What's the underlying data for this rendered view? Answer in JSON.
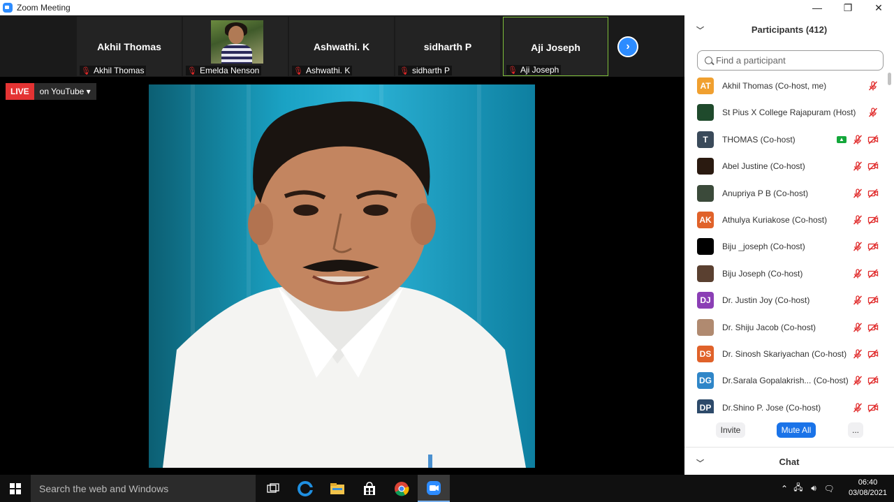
{
  "window": {
    "title": "Zoom Meeting",
    "controls": {
      "minimize": "—",
      "restore": "❐",
      "close": "✕"
    }
  },
  "video_strip": {
    "tiles": [
      {
        "big_name": "Akhil Thomas",
        "label": "Akhil Thomas",
        "has_photo": false,
        "active": false
      },
      {
        "big_name": "",
        "label": "Emelda Nenson",
        "has_photo": true,
        "active": false
      },
      {
        "big_name": "Ashwathi. K",
        "label": "Ashwathi. K",
        "has_photo": false,
        "active": false
      },
      {
        "big_name": "sidharth P",
        "label": "sidharth P",
        "has_photo": false,
        "active": false
      },
      {
        "big_name": "Aji Joseph",
        "label": "Aji Joseph",
        "has_photo": false,
        "active": true
      }
    ],
    "next_icon": "chevron-right-icon"
  },
  "live": {
    "badge": "LIVE",
    "platform": "on YouTube ▾"
  },
  "participants_panel": {
    "title": "Participants (412)",
    "search_placeholder": "Find a participant",
    "participants": [
      {
        "initials": "AT",
        "color": "#f0a030",
        "name": "Akhil Thomas (Co-host, me)",
        "mic_muted": true,
        "video_off": false,
        "sharing": false,
        "avatar_type": "initials"
      },
      {
        "initials": "",
        "color": "#1f4a2c",
        "name": "St Pius X College Rajapuram (Host)",
        "mic_muted": true,
        "video_off": false,
        "sharing": false,
        "avatar_type": "photo"
      },
      {
        "initials": "T",
        "color": "#3a4a5a",
        "name": "THOMAS (Co-host)",
        "mic_muted": true,
        "video_off": true,
        "sharing": true,
        "avatar_type": "initials"
      },
      {
        "initials": "",
        "color": "#2a1a10",
        "name": "Abel Justine (Co-host)",
        "mic_muted": true,
        "video_off": true,
        "sharing": false,
        "avatar_type": "photo"
      },
      {
        "initials": "",
        "color": "#3b4a3a",
        "name": "Anupriya P B (Co-host)",
        "mic_muted": true,
        "video_off": true,
        "sharing": false,
        "avatar_type": "photo"
      },
      {
        "initials": "AK",
        "color": "#e0622a",
        "name": "Athulya Kuriakose (Co-host)",
        "mic_muted": true,
        "video_off": true,
        "sharing": false,
        "avatar_type": "initials"
      },
      {
        "initials": "",
        "color": "#000000",
        "name": "Biju _joseph (Co-host)",
        "mic_muted": true,
        "video_off": true,
        "sharing": false,
        "avatar_type": "photo"
      },
      {
        "initials": "",
        "color": "#5a4030",
        "name": "Biju Joseph (Co-host)",
        "mic_muted": true,
        "video_off": true,
        "sharing": false,
        "avatar_type": "photo"
      },
      {
        "initials": "DJ",
        "color": "#8b3fb5",
        "name": "Dr. Justin Joy (Co-host)",
        "mic_muted": true,
        "video_off": true,
        "sharing": false,
        "avatar_type": "initials"
      },
      {
        "initials": "",
        "color": "#b08a70",
        "name": "Dr. Shiju Jacob (Co-host)",
        "mic_muted": true,
        "video_off": true,
        "sharing": false,
        "avatar_type": "photo"
      },
      {
        "initials": "DS",
        "color": "#e0622a",
        "name": "Dr. Sinosh Skariyachan (Co-host)",
        "mic_muted": true,
        "video_off": true,
        "sharing": false,
        "avatar_type": "initials"
      },
      {
        "initials": "DG",
        "color": "#2f86c8",
        "name": "Dr.Sarala Gopalakrish... (Co-host)",
        "mic_muted": true,
        "video_off": true,
        "sharing": false,
        "avatar_type": "initials"
      },
      {
        "initials": "DP",
        "color": "#2d4a6a",
        "name": "Dr.Shino P. Jose (Co-host)",
        "mic_muted": true,
        "video_off": true,
        "sharing": false,
        "avatar_type": "initials"
      }
    ],
    "buttons": {
      "invite": "Invite",
      "mute_all": "Mute All",
      "more": "..."
    },
    "chat_title": "Chat"
  },
  "taskbar": {
    "search_placeholder": "Search the web and Windows",
    "time": "06:40",
    "date": "03/08/2021"
  }
}
